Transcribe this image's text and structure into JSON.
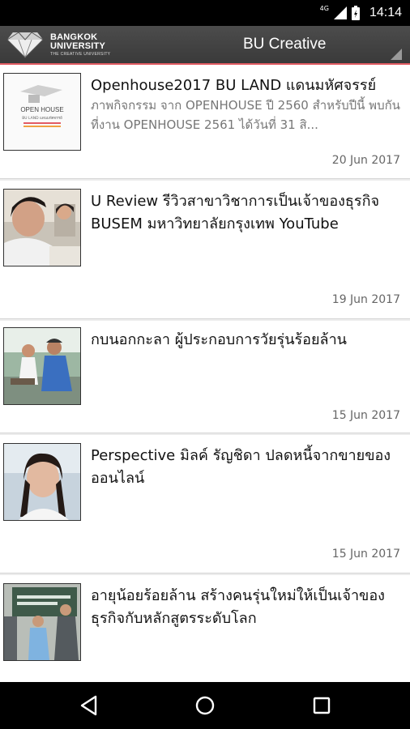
{
  "status_bar": {
    "network": "4G",
    "time": "14:14",
    "icons": [
      "signal-icon",
      "battery-icon"
    ]
  },
  "app_bar": {
    "logo": {
      "line1": "BANGKOK",
      "line2": "UNIVERSITY",
      "line3": "THE CREATIVE UNIVERSITY"
    },
    "title": "BU Creative",
    "accent_color": "#e25b63"
  },
  "feed": {
    "items": [
      {
        "title": "Openhouse2017 BU LAND แดนมหัศจรรย์",
        "description": "ภาพกิจกรรม จาก OPENHOUSE ปี 2560 สำหรับปีนี้ พบกันที่งาน OPENHOUSE 2561 ได้วันที่ 31 สิ...",
        "date": "20 Jun 2017",
        "thumb_text": [
          "OPEN HOUSE",
          "BU LAND แดนมหัศจรรย์"
        ]
      },
      {
        "title": "U Review รีวิวสาขาวิชาการเป็นเจ้าของธุรกิจ BUSEM มหาวิทยาลัยกรุงเทพ   YouTube",
        "description": "",
        "date": "19 Jun 2017"
      },
      {
        "title": "กบนอกกะลา   ผู้ประกอบการวัยรุ่นร้อยล้าน",
        "description": "",
        "date": "15 Jun 2017"
      },
      {
        "title": "Perspective มิลค์ รัญชิดา ปลดหนี้จากขายของออนไลน์",
        "description": "",
        "date": "15 Jun 2017"
      },
      {
        "title": "อายุน้อยร้อยล้าน สร้างคนรุ่นใหม่ให้เป็นเจ้าของธุรกิจกับหลักสูตรระดับโลก",
        "description": "",
        "date": ""
      }
    ]
  },
  "nav_bar": {
    "buttons": [
      "back-icon",
      "home-icon",
      "recents-icon"
    ]
  }
}
